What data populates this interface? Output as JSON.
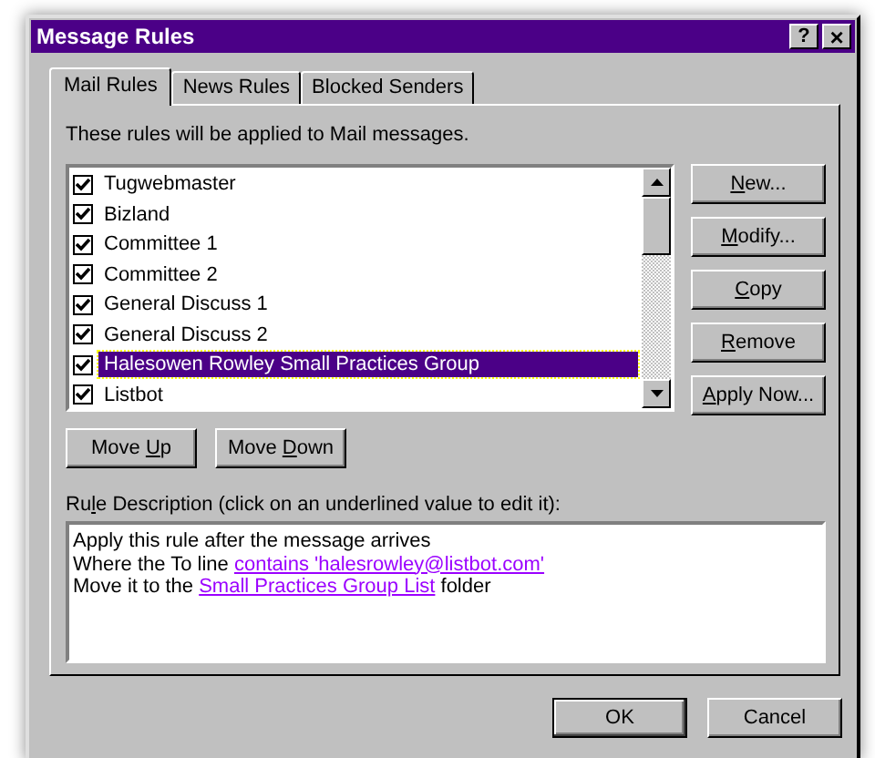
{
  "window": {
    "title": "Message Rules",
    "title_buttons": [
      {
        "kind": "help",
        "label": "?"
      },
      {
        "kind": "close",
        "label": "×"
      }
    ]
  },
  "tabs": [
    {
      "label": "Mail Rules",
      "selected": true
    },
    {
      "label": "News Rules",
      "selected": false
    },
    {
      "label": "Blocked Senders",
      "selected": false
    }
  ],
  "intro": "These rules will be applied to Mail messages.",
  "rules": [
    {
      "name": "Tugwebmaster",
      "checked": true,
      "selected": false
    },
    {
      "name": "Bizland",
      "checked": true,
      "selected": false
    },
    {
      "name": "Committee 1",
      "checked": true,
      "selected": false
    },
    {
      "name": "Committee 2",
      "checked": true,
      "selected": false
    },
    {
      "name": "General Discuss 1",
      "checked": true,
      "selected": false
    },
    {
      "name": "General Discuss 2",
      "checked": true,
      "selected": false
    },
    {
      "name": "Halesowen Rowley Small Practices Group",
      "checked": true,
      "selected": true
    },
    {
      "name": "Listbot",
      "checked": true,
      "selected": false
    }
  ],
  "side_buttons": [
    {
      "access_key": "N",
      "after": "ew..."
    },
    {
      "access_key": "M",
      "after": "odify..."
    },
    {
      "access_key": "C",
      "after": "opy"
    },
    {
      "access_key": "R",
      "after": "emove"
    },
    {
      "access_key": "A",
      "after": "pply Now..."
    }
  ],
  "move_buttons": [
    {
      "before": "Move ",
      "access_key": "U",
      "after": "p"
    },
    {
      "before": "Move ",
      "access_key": "D",
      "after": "own"
    }
  ],
  "description": {
    "label": {
      "before": "Ru",
      "access_key": "l",
      "after": "e Description (click on an underlined value to edit it):"
    },
    "lines": [
      [
        {
          "kind": "text",
          "text": "Apply this rule after the message arrives"
        }
      ],
      [
        {
          "kind": "text",
          "text": "Where the To line "
        },
        {
          "kind": "link",
          "text": "contains 'halesrowley@listbot.com'"
        }
      ],
      [
        {
          "kind": "text",
          "text": "Move it to the "
        },
        {
          "kind": "link",
          "text": "Small Practices Group List"
        },
        {
          "kind": "text",
          "text": " folder"
        }
      ]
    ]
  },
  "buttons": [
    {
      "label": "OK",
      "default": true
    },
    {
      "label": "Cancel",
      "default": false
    }
  ]
}
